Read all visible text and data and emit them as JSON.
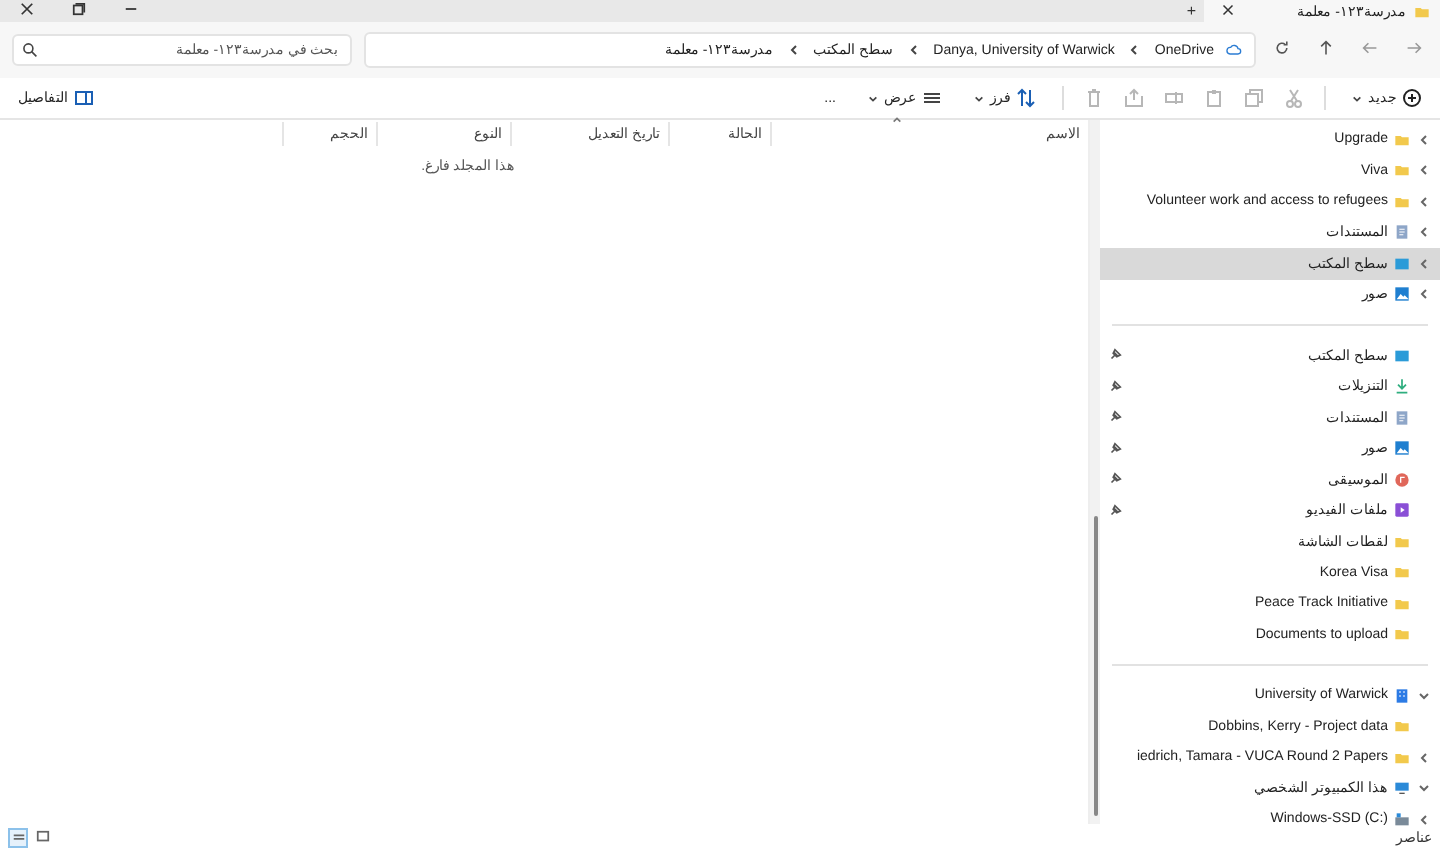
{
  "window": {
    "tab_title": "مدرسة١٢٣- معلمة",
    "new_tab": "+"
  },
  "address_bar": {
    "breadcrumbs": [
      "OneDrive",
      "Danya, University of Warwick",
      "سطح المكتب",
      "مدرسة١٢٣- معلمة"
    ],
    "search": {
      "placeholder": "بحث في مدرسة١٢٣- معلمة"
    }
  },
  "toolbar": {
    "new": "جديد",
    "sort": "فرز",
    "view": "عرض",
    "more": "...",
    "details": "التفاصيل"
  },
  "columns": [
    "الاسم",
    "الحالة",
    "تاريخ التعديل",
    "النوع",
    "الحجم"
  ],
  "empty_message": "هذا المجلد فارغ.",
  "sidebar": {
    "sections": [
      {
        "items": [
          {
            "label": "Upgrade",
            "kind": "folder",
            "expanded": false,
            "selected": false
          },
          {
            "label": "Viva",
            "kind": "folder",
            "expanded": false,
            "selected": false
          },
          {
            "label": "Volunteer work and access to refugees",
            "kind": "folder",
            "expanded": false,
            "selected": false
          },
          {
            "label": "المستندات",
            "kind": "documents",
            "expanded": false,
            "selected": false
          },
          {
            "label": "سطح المكتب",
            "kind": "desktop",
            "expanded": false,
            "selected": true
          },
          {
            "label": "صور",
            "kind": "pictures",
            "expanded": false,
            "selected": false
          }
        ]
      },
      {
        "items": [
          {
            "label": "سطح المكتب",
            "kind": "desktop",
            "pinned": true,
            "selected": false
          },
          {
            "label": "التنزيلات",
            "kind": "downloads",
            "pinned": true,
            "selected": false
          },
          {
            "label": "المستندات",
            "kind": "documents",
            "pinned": true,
            "selected": false
          },
          {
            "label": "صور",
            "kind": "pictures",
            "pinned": true,
            "selected": false
          },
          {
            "label": "الموسيقى",
            "kind": "music",
            "pinned": true,
            "selected": false
          },
          {
            "label": "ملفات الفيديو",
            "kind": "videos",
            "pinned": true,
            "selected": false
          },
          {
            "label": "لقطات الشاشة",
            "kind": "folder",
            "pinned": false,
            "selected": false
          },
          {
            "label": "Korea Visa",
            "kind": "folder",
            "pinned": false,
            "selected": false
          },
          {
            "label": "Peace Track Initiative",
            "kind": "folder",
            "pinned": false,
            "selected": false
          },
          {
            "label": "Documents to upload",
            "kind": "folder",
            "pinned": false,
            "selected": false
          }
        ]
      },
      {
        "items": [
          {
            "label": "University of Warwick",
            "kind": "building",
            "expanded": true,
            "selected": false
          },
          {
            "label": "Dobbins, Kerry - Project data",
            "kind": "folder",
            "selected": false
          },
          {
            "label": "iedrich, Tamara - VUCA Round 2 Papers",
            "kind": "folder",
            "expanded": false,
            "selected": false
          },
          {
            "label": "هذا الكمبيوتر الشخصي",
            "kind": "pc",
            "expanded": true,
            "selected": false
          },
          {
            "label": "Windows-SSD (C:)",
            "kind": "drive",
            "expanded": false,
            "selected": false
          }
        ]
      }
    ]
  },
  "status_bar": {
    "text": "عناصر",
    "views": [
      {
        "kind": "tiles",
        "selected": false
      },
      {
        "kind": "details",
        "selected": true
      }
    ]
  }
}
